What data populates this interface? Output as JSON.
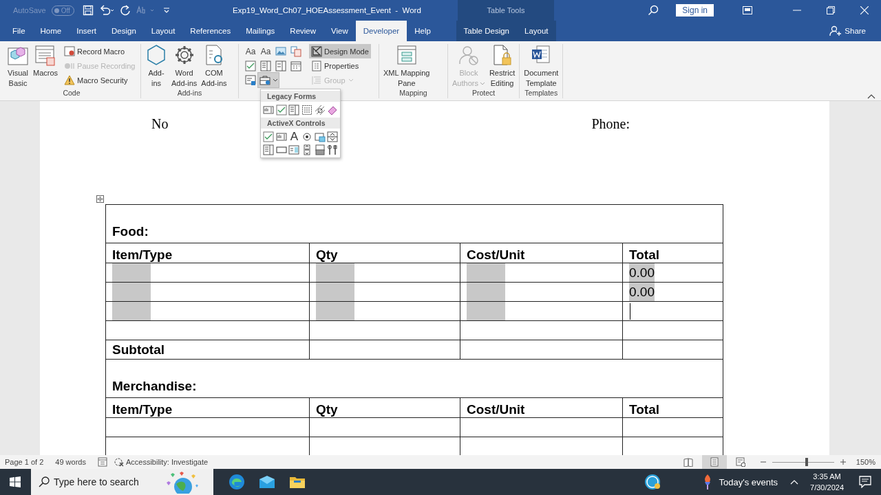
{
  "window": {
    "autosave": {
      "label": "AutoSave",
      "state": "Off",
      "on": false
    },
    "title": "Exp19_Word_Ch07_HOEAssessment_Event  -  Word",
    "contextual_group": "Table Tools",
    "sign_in": "Sign in"
  },
  "tabs": [
    {
      "label": "File",
      "selected": false,
      "contextual": false
    },
    {
      "label": "Home",
      "selected": false,
      "contextual": false
    },
    {
      "label": "Insert",
      "selected": false,
      "contextual": false
    },
    {
      "label": "Design",
      "selected": false,
      "contextual": false
    },
    {
      "label": "Layout",
      "selected": false,
      "contextual": false
    },
    {
      "label": "References",
      "selected": false,
      "contextual": false
    },
    {
      "label": "Mailings",
      "selected": false,
      "contextual": false
    },
    {
      "label": "Review",
      "selected": false,
      "contextual": false
    },
    {
      "label": "View",
      "selected": false,
      "contextual": false
    },
    {
      "label": "Developer",
      "selected": true,
      "contextual": false
    },
    {
      "label": "Help",
      "selected": false,
      "contextual": false
    },
    {
      "label": "Table Design",
      "selected": false,
      "contextual": true
    },
    {
      "label": "Layout",
      "selected": false,
      "contextual": true
    }
  ],
  "share": "Share",
  "ribbon": {
    "groups": [
      {
        "label": "Code",
        "items": [
          {
            "kind": "large",
            "lines": [
              "Visual",
              "Basic"
            ],
            "disabled": false,
            "pressed": false
          },
          {
            "kind": "large",
            "lines": [
              "Macros"
            ],
            "disabled": false,
            "pressed": false
          },
          {
            "kind": "stack",
            "items": [
              {
                "label": "Record Macro",
                "disabled": false,
                "pressed": false
              },
              {
                "label": "Pause Recording",
                "disabled": true,
                "pressed": false
              },
              {
                "label": "Macro Security",
                "disabled": false,
                "pressed": false
              }
            ]
          }
        ]
      },
      {
        "label": "Add-ins",
        "items": [
          {
            "kind": "large",
            "lines": [
              "Add-",
              "ins"
            ],
            "disabled": false,
            "pressed": false
          },
          {
            "kind": "large",
            "lines": [
              "Word",
              "Add-ins"
            ],
            "disabled": false,
            "pressed": false
          },
          {
            "kind": "large",
            "lines": [
              "COM",
              "Add-ins"
            ],
            "disabled": false,
            "pressed": false
          }
        ]
      },
      {
        "items": [
          {
            "kind": "controls",
            "text_icons": [
              "Aa",
              "Aa"
            ],
            "tools_expanded": true,
            "menu": {
              "sections": [
                {
                  "title": "Legacy Forms"
                },
                {
                  "title": "ActiveX Controls",
                  "text_icon": "A"
                }
              ]
            }
          },
          {
            "kind": "stack",
            "items": [
              {
                "label": "Design Mode",
                "disabled": false,
                "pressed": true
              },
              {
                "label": "Properties",
                "disabled": false,
                "pressed": false
              },
              {
                "label": "Group",
                "disabled": true,
                "pressed": false,
                "dropdown": true
              }
            ]
          }
        ]
      },
      {
        "label": "Mapping",
        "items": [
          {
            "kind": "large",
            "lines": [
              "XML Mapping",
              "Pane"
            ],
            "disabled": false,
            "pressed": false
          }
        ]
      },
      {
        "label": "Protect",
        "items": [
          {
            "kind": "large",
            "lines": [
              "Block",
              "Authors"
            ],
            "disabled": true,
            "pressed": false,
            "dropdown": true
          },
          {
            "kind": "large",
            "lines": [
              "Restrict",
              "Editing"
            ],
            "disabled": false,
            "pressed": false
          }
        ]
      },
      {
        "label": "Templates",
        "items": [
          {
            "kind": "large",
            "lines": [
              "Document",
              "Template"
            ],
            "disabled": false,
            "pressed": false
          }
        ]
      }
    ]
  },
  "document": {
    "contact_labels": [
      "No",
      "Phone:"
    ],
    "table": {
      "rows": [
        {
          "kind": "heading",
          "text": "Food:"
        },
        {
          "kind": "header",
          "cells": [
            "Item/Type",
            "Qty",
            "Cost/Unit",
            "Total"
          ]
        },
        {
          "kind": "data",
          "cells": [
            {
              "kind": "control"
            },
            {
              "kind": "control"
            },
            {
              "kind": "control"
            },
            {
              "kind": "control",
              "text": "0.00"
            }
          ]
        },
        {
          "kind": "data",
          "cells": [
            {
              "kind": "control"
            },
            {
              "kind": "control"
            },
            {
              "kind": "control"
            },
            {
              "kind": "control",
              "text": "0.00"
            }
          ]
        },
        {
          "kind": "data",
          "cells": [
            {
              "kind": "control"
            },
            {
              "kind": "control"
            },
            {
              "kind": "control"
            },
            {
              "kind": "cursor"
            }
          ]
        },
        {
          "kind": "data",
          "cells": [
            {
              "kind": "empty"
            },
            {
              "kind": "empty"
            },
            {
              "kind": "empty"
            },
            {
              "kind": "empty"
            }
          ]
        },
        {
          "kind": "data",
          "cells": [
            {
              "kind": "label",
              "text": "Subtotal"
            },
            {
              "kind": "empty"
            },
            {
              "kind": "empty"
            },
            {
              "kind": "empty"
            }
          ]
        },
        {
          "kind": "heading",
          "text": "Merchandise:"
        },
        {
          "kind": "header",
          "cells": [
            "Item/Type",
            "Qty",
            "Cost/Unit",
            "Total"
          ]
        },
        {
          "kind": "data",
          "cells": [
            {
              "kind": "empty"
            },
            {
              "kind": "empty"
            },
            {
              "kind": "empty"
            },
            {
              "kind": "empty"
            }
          ]
        },
        {
          "kind": "data",
          "cells": [
            {
              "kind": "empty"
            },
            {
              "kind": "empty"
            },
            {
              "kind": "empty"
            },
            {
              "kind": "empty"
            }
          ]
        }
      ]
    }
  },
  "status_bar": {
    "page": "Page 1 of 2",
    "words": "49 words",
    "accessibility": "Accessibility: Investigate",
    "views": [
      {
        "selected": false
      },
      {
        "selected": true
      },
      {
        "selected": false
      }
    ],
    "zoom": {
      "level": 0.56,
      "reading": "150%"
    }
  },
  "taskbar": {
    "search_placeholder": "Type here to search",
    "news": "Today's events",
    "time": "3:35 AM",
    "date": "7/30/2024"
  }
}
